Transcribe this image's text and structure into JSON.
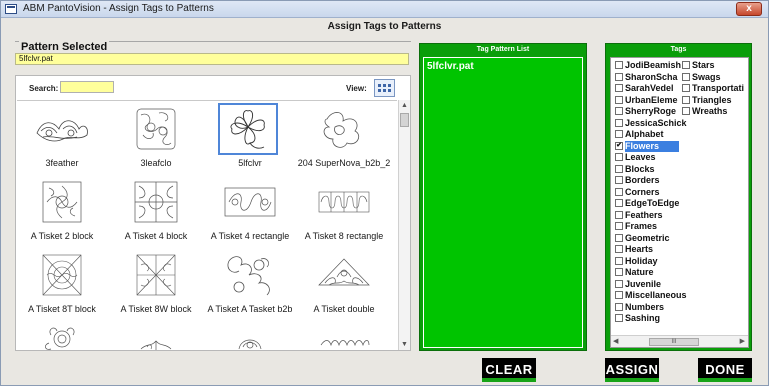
{
  "window": {
    "title": "ABM PantoVision -  Assign Tags to Patterns",
    "close_glyph": "x"
  },
  "dialog": {
    "title": "Assign Tags to Patterns"
  },
  "pattern_selected": {
    "label": "Pattern Selected",
    "value": "5lfclvr.pat"
  },
  "browser": {
    "search_label": "Search:",
    "search_value": "",
    "view_label": "View:",
    "view_icon": "grid-view-icon",
    "patterns": [
      {
        "caption": "3feather",
        "icon": "feather-pattern-icon",
        "selected": false
      },
      {
        "caption": "3leafclo",
        "icon": "leaf-clover-pattern-icon",
        "selected": false
      },
      {
        "caption": "5lfclvr",
        "icon": "five-leaf-clover-pattern-icon",
        "selected": true
      },
      {
        "caption": "204 SuperNova_b2b_2",
        "icon": "supernova-pattern-icon",
        "selected": false
      },
      {
        "caption": "A Tisket 2 block",
        "icon": "tisket-2-block-icon",
        "selected": false
      },
      {
        "caption": "A Tisket 4 block",
        "icon": "tisket-4-block-icon",
        "selected": false
      },
      {
        "caption": "A Tisket 4 rectangle",
        "icon": "tisket-4-rectangle-icon",
        "selected": false
      },
      {
        "caption": "A Tisket 8 rectangle",
        "icon": "tisket-8-rectangle-icon",
        "selected": false
      },
      {
        "caption": "A Tisket 8T block",
        "icon": "tisket-8t-block-icon",
        "selected": false
      },
      {
        "caption": "A Tisket 8W block",
        "icon": "tisket-8w-block-icon",
        "selected": false
      },
      {
        "caption": "A Tisket A Tasket b2b",
        "icon": "tisket-a-tasket-icon",
        "selected": false
      },
      {
        "caption": "A Tisket double",
        "icon": "tisket-double-icon",
        "selected": false
      },
      {
        "caption": "",
        "icon": "pattern-partial-icon",
        "selected": false
      },
      {
        "caption": "",
        "icon": "pattern-partial-icon",
        "selected": false
      },
      {
        "caption": "",
        "icon": "pattern-partial-icon",
        "selected": false
      },
      {
        "caption": "",
        "icon": "pattern-partial-icon",
        "selected": false
      }
    ]
  },
  "tag_pattern_list": {
    "header": "Tag Pattern List",
    "items": [
      "5lfclvr.pat"
    ]
  },
  "tags": {
    "header": "Tags",
    "col2": [
      {
        "label": "Stars",
        "checked": false
      },
      {
        "label": "Swags",
        "checked": false
      },
      {
        "label": "Transportati",
        "checked": false
      },
      {
        "label": "Triangles",
        "checked": false
      },
      {
        "label": "Wreaths",
        "checked": false
      }
    ],
    "col1": [
      {
        "label": "JodiBeamish",
        "checked": false
      },
      {
        "label": "SharonScha",
        "checked": false
      },
      {
        "label": "SarahVedel",
        "checked": false
      },
      {
        "label": "UrbanEleme",
        "checked": false
      },
      {
        "label": "SherryRoge",
        "checked": false
      },
      {
        "label": "JessicaSchick",
        "checked": false
      },
      {
        "label": "Alphabet",
        "checked": false
      },
      {
        "label": "Flowers",
        "checked": true,
        "selected": true
      },
      {
        "label": "Leaves",
        "checked": false
      },
      {
        "label": "Blocks",
        "checked": false
      },
      {
        "label": "Borders",
        "checked": false
      },
      {
        "label": "Corners",
        "checked": false
      },
      {
        "label": "EdgeToEdge",
        "checked": false
      },
      {
        "label": "Feathers",
        "checked": false
      },
      {
        "label": "Frames",
        "checked": false
      },
      {
        "label": "Geometric",
        "checked": false
      },
      {
        "label": "Hearts",
        "checked": false
      },
      {
        "label": "Holiday",
        "checked": false
      },
      {
        "label": "Nature",
        "checked": false
      },
      {
        "label": "Juvenile",
        "checked": false
      },
      {
        "label": "Miscellaneous",
        "checked": false
      },
      {
        "label": "Numbers",
        "checked": false
      },
      {
        "label": "Sashing",
        "checked": false
      }
    ],
    "scroll_thumb": "III"
  },
  "buttons": {
    "clear": "CLEAR",
    "assign": "ASSIGN",
    "done": "DONE"
  },
  "colors": {
    "panel_green": "#0a9e0a",
    "list_green": "#00c400",
    "input_yellow": "#ffff9b",
    "selection_blue": "#3b7fe0",
    "button_black": "#000000"
  }
}
